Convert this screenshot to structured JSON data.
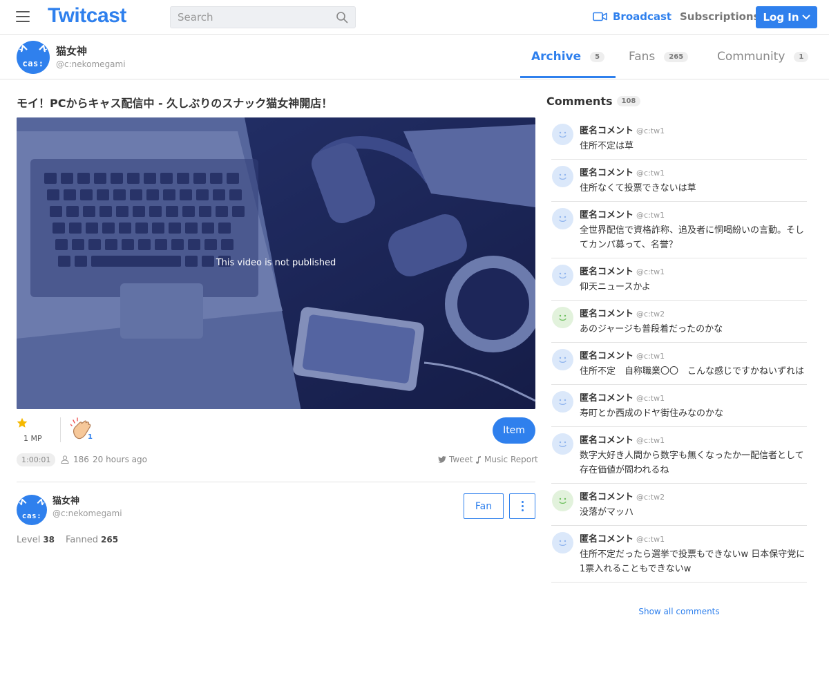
{
  "header": {
    "logo": "Twitcast",
    "search_placeholder": "Search",
    "broadcast": "Broadcast",
    "subscriptions": "Subscriptions",
    "login": "Log In"
  },
  "user": {
    "name": "猫女神",
    "handle": "@c:nekomegami",
    "avatar_text": "cas:"
  },
  "tabs": [
    {
      "label": "Archive",
      "count": "5"
    },
    {
      "label": "Fans",
      "count": "265"
    },
    {
      "label": "Community",
      "count": "1"
    }
  ],
  "video": {
    "title": "モイ！PCからキャス配信中 - 久しぶりのスナック猫女神開店！",
    "message": "This video is not published",
    "mp": "1 MP",
    "clap_count": "1",
    "item_button": "Item",
    "duration": "1:00:01",
    "viewers": "186",
    "time_ago": "20 hours ago",
    "tweet": "Tweet",
    "music_report": "Music Report"
  },
  "owner": {
    "name": "猫女神",
    "handle": "@c:nekomegami",
    "fan_button": "Fan",
    "level_label": "Level",
    "level": "38",
    "fanned_label": "Fanned",
    "fanned": "265"
  },
  "comments": {
    "title": "Comments",
    "count": "108",
    "show_all": "Show all comments",
    "items": [
      {
        "name": "匿名コメント",
        "handle": "@c:tw1",
        "text": "住所不定は草",
        "color": "blue"
      },
      {
        "name": "匿名コメント",
        "handle": "@c:tw1",
        "text": "住所なくて投票できないは草",
        "color": "blue"
      },
      {
        "name": "匿名コメント",
        "handle": "@c:tw1",
        "text": "全世界配信で資格詐称、追及者に恫喝紛いの言動。そしてカンパ募って、名誉？",
        "color": "blue"
      },
      {
        "name": "匿名コメント",
        "handle": "@c:tw1",
        "text": "仰天ニュースかよ",
        "color": "blue"
      },
      {
        "name": "匿名コメント",
        "handle": "@c:tw2",
        "text": "あのジャージも普段着だったのかな",
        "color": "green"
      },
      {
        "name": "匿名コメント",
        "handle": "@c:tw1",
        "text": "住所不定　自称職業〇〇　こんな感じですかねいずれは",
        "color": "blue"
      },
      {
        "name": "匿名コメント",
        "handle": "@c:tw1",
        "text": "寿町とか西成のドヤ街住みなのかな",
        "color": "blue"
      },
      {
        "name": "匿名コメント",
        "handle": "@c:tw1",
        "text": "数字大好き人間から数字も無くなったか一配信者として存在価値が問われるね",
        "color": "blue"
      },
      {
        "name": "匿名コメント",
        "handle": "@c:tw2",
        "text": "没落がマッハ",
        "color": "green"
      },
      {
        "name": "匿名コメント",
        "handle": "@c:tw1",
        "text": "住所不定だったら選挙で投票もできないw 日本保守党に1票入れることもできないw",
        "color": "blue"
      }
    ]
  },
  "colors": {
    "accent": "#2f80ed",
    "avatar_blue": "#dbe8fa",
    "avatar_green": "#e2f2dc"
  }
}
